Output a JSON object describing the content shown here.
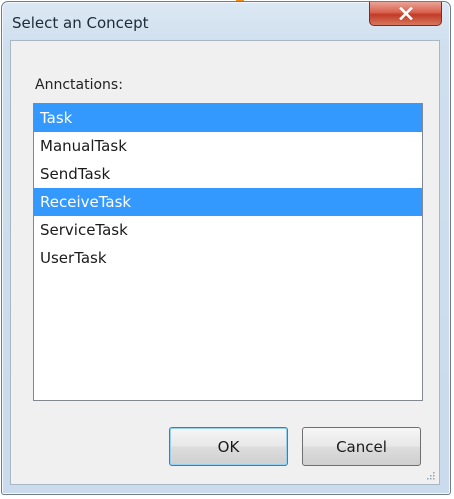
{
  "window": {
    "title": "Select an Concept",
    "close_icon": "close-icon"
  },
  "list": {
    "label": "Annctations:",
    "items": [
      {
        "label": "Task",
        "selected": true
      },
      {
        "label": "ManualTask",
        "selected": false
      },
      {
        "label": "SendTask",
        "selected": false
      },
      {
        "label": "ReceiveTask",
        "selected": true
      },
      {
        "label": "ServiceTask",
        "selected": false
      },
      {
        "label": "UserTask",
        "selected": false
      }
    ]
  },
  "buttons": {
    "ok_label": "OK",
    "cancel_label": "Cancel"
  },
  "colors": {
    "selection": "#3399ff",
    "accent": "#f08a1c"
  }
}
